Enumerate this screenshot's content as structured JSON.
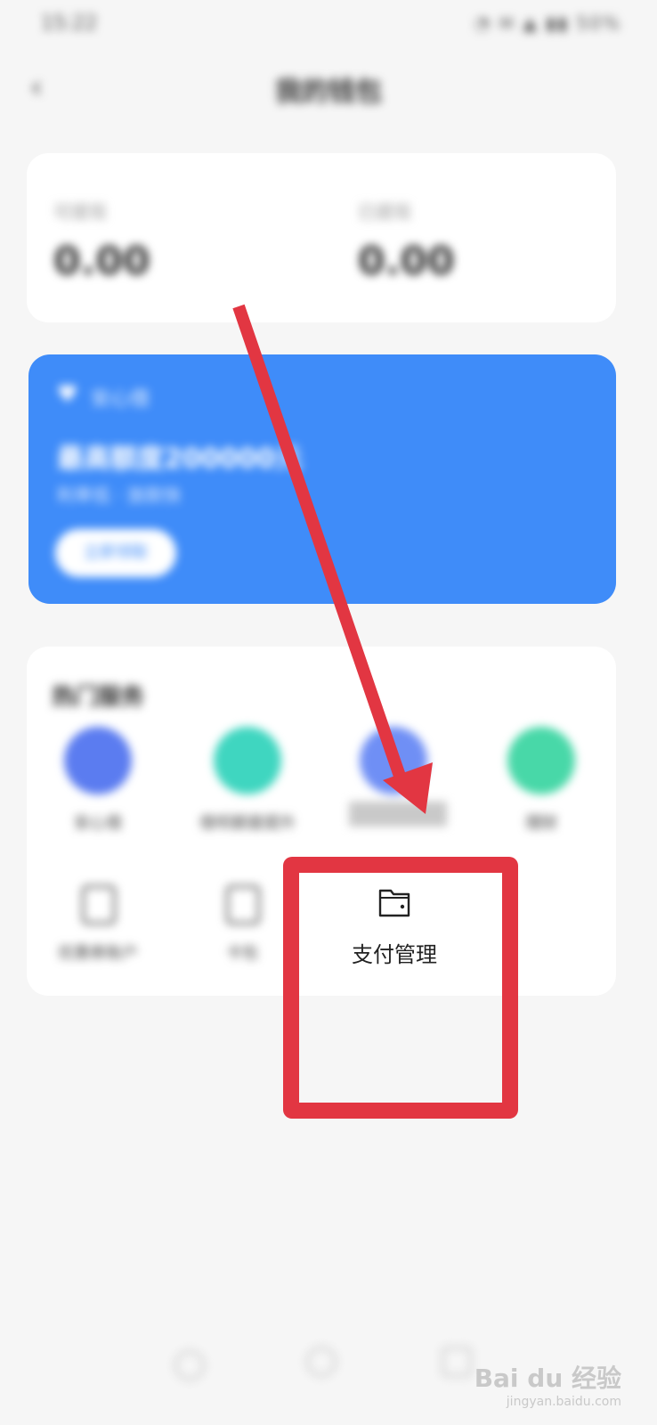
{
  "status_bar": {
    "time": "15:22",
    "icons": "◔ ✉ ▲ ▮▮ 50%"
  },
  "header": {
    "back_icon": "back-icon",
    "title": "我的钱包"
  },
  "balance": {
    "left_label": "可提现",
    "left_value": "0.00",
    "right_label": "已提现",
    "right_value": "0.00"
  },
  "promo": {
    "tag": "安心借",
    "title": "最高额度200000元",
    "subtitle": "利率低  · 放款快",
    "button": "立即领取"
  },
  "services": {
    "title": "热门服务",
    "row1": [
      {
        "label": "安心借",
        "color": "#5b7cf0"
      },
      {
        "label": "借呗额度提升",
        "color": "#3fd6c0"
      },
      {
        "label": "",
        "color": "#6f8ff5"
      },
      {
        "label": "理财",
        "color": "#48d8a8"
      }
    ],
    "row2": [
      {
        "label": "优惠券账户"
      },
      {
        "label": "卡包"
      }
    ]
  },
  "highlight": {
    "label": "支付管理",
    "icon": "wallet-icon",
    "color": "#e23642"
  },
  "arrow": {
    "color": "#e23642"
  },
  "watermark": {
    "main": "Bai du 经验",
    "url": "jingyan.baidu.com"
  }
}
